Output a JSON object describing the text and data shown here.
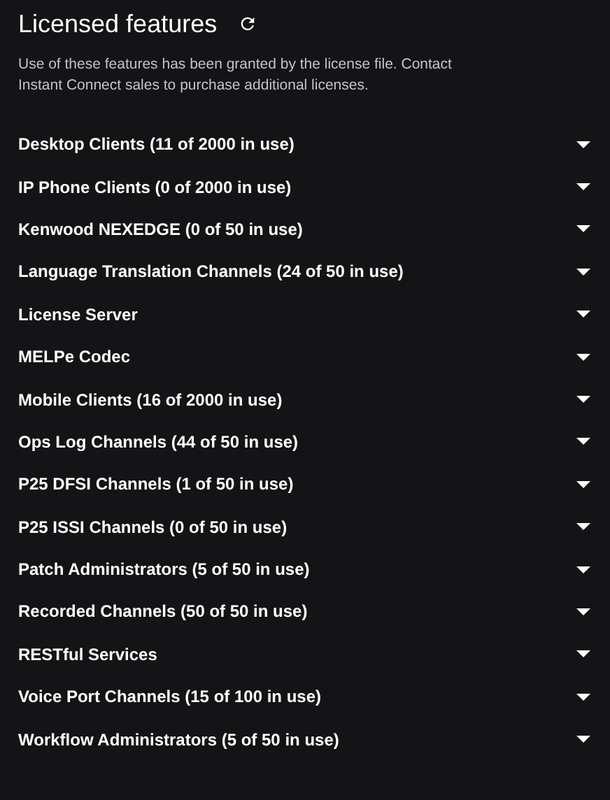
{
  "header": {
    "title": "Licensed features",
    "description": "Use of these features has been granted by the license file. Contact Instant Connect sales to purchase additional licenses."
  },
  "features": [
    {
      "label": "Desktop Clients (11 of 2000 in use)",
      "expanded": false
    },
    {
      "label": "IP Phone Clients (0 of 2000 in use)",
      "expanded": false
    },
    {
      "label": "Kenwood NEXEDGE (0 of 50 in use)",
      "expanded": false
    },
    {
      "label": "Language Translation Channels (24 of 50 in use)",
      "expanded": false
    },
    {
      "label": "License Server",
      "expanded": false
    },
    {
      "label": "MELPe Codec",
      "expanded": false
    },
    {
      "label": "Mobile Clients (16 of 2000 in use)",
      "expanded": false
    },
    {
      "label": "Ops Log Channels (44 of 50 in use)",
      "expanded": false
    },
    {
      "label": "P25 DFSI Channels (1 of 50 in use)",
      "expanded": false
    },
    {
      "label": "P25 ISSI Channels (0 of 50 in use)",
      "expanded": false
    },
    {
      "label": "Patch Administrators (5 of 50 in use)",
      "expanded": false
    },
    {
      "label": "Recorded Channels (50 of 50 in use)",
      "expanded": false
    },
    {
      "label": "RESTful Services",
      "expanded": false
    },
    {
      "label": "Voice Port Channels (15 of 100 in use)",
      "expanded": false
    },
    {
      "label": "Workflow Administrators (5 of 50 in use)",
      "expanded": false
    }
  ]
}
